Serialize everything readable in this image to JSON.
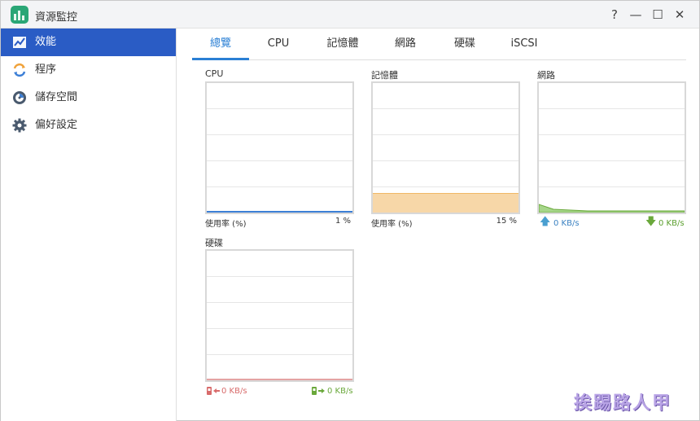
{
  "window": {
    "title": "資源監控"
  },
  "title_controls": [
    {
      "name": "help-icon",
      "glyph": "?"
    },
    {
      "name": "minimize-icon",
      "glyph": "—"
    },
    {
      "name": "maximize-icon",
      "glyph": "☐"
    },
    {
      "name": "close-icon",
      "glyph": "✕"
    }
  ],
  "sidebar": {
    "items": [
      {
        "label": "效能",
        "icon": "performance-chart-icon",
        "active": true
      },
      {
        "label": "程序",
        "icon": "process-sync-icon",
        "active": false
      },
      {
        "label": "儲存空間",
        "icon": "storage-disk-icon",
        "active": false
      },
      {
        "label": "偏好設定",
        "icon": "gear-icon",
        "active": false
      }
    ]
  },
  "tabs": [
    {
      "label": "總覽",
      "active": true
    },
    {
      "label": "CPU",
      "active": false
    },
    {
      "label": "記憶體",
      "active": false
    },
    {
      "label": "網路",
      "active": false
    },
    {
      "label": "硬碟",
      "active": false
    },
    {
      "label": "iSCSI",
      "active": false
    }
  ],
  "panels": {
    "cpu": {
      "title": "CPU",
      "usage_label": "使用率 (%)",
      "usage_value": "1 %",
      "level": 0.01,
      "color": "#3c7fd6"
    },
    "memory": {
      "title": "記憶體",
      "usage_label": "使用率 (%)",
      "usage_value": "15 %",
      "level": 0.15,
      "color": "#f7d7a8"
    },
    "network": {
      "title": "網路",
      "upload": "0 KB/s",
      "download": "0 KB/s",
      "color": "#8dc86a"
    },
    "disk": {
      "title": "硬碟",
      "read": "0 KB/s",
      "write": "0 KB/s",
      "color": "#e4a3a3"
    }
  },
  "colors": {
    "accent": "#2a5cc5",
    "tab_active": "#2a7fd4"
  },
  "watermark": "挨踢路人甲"
}
